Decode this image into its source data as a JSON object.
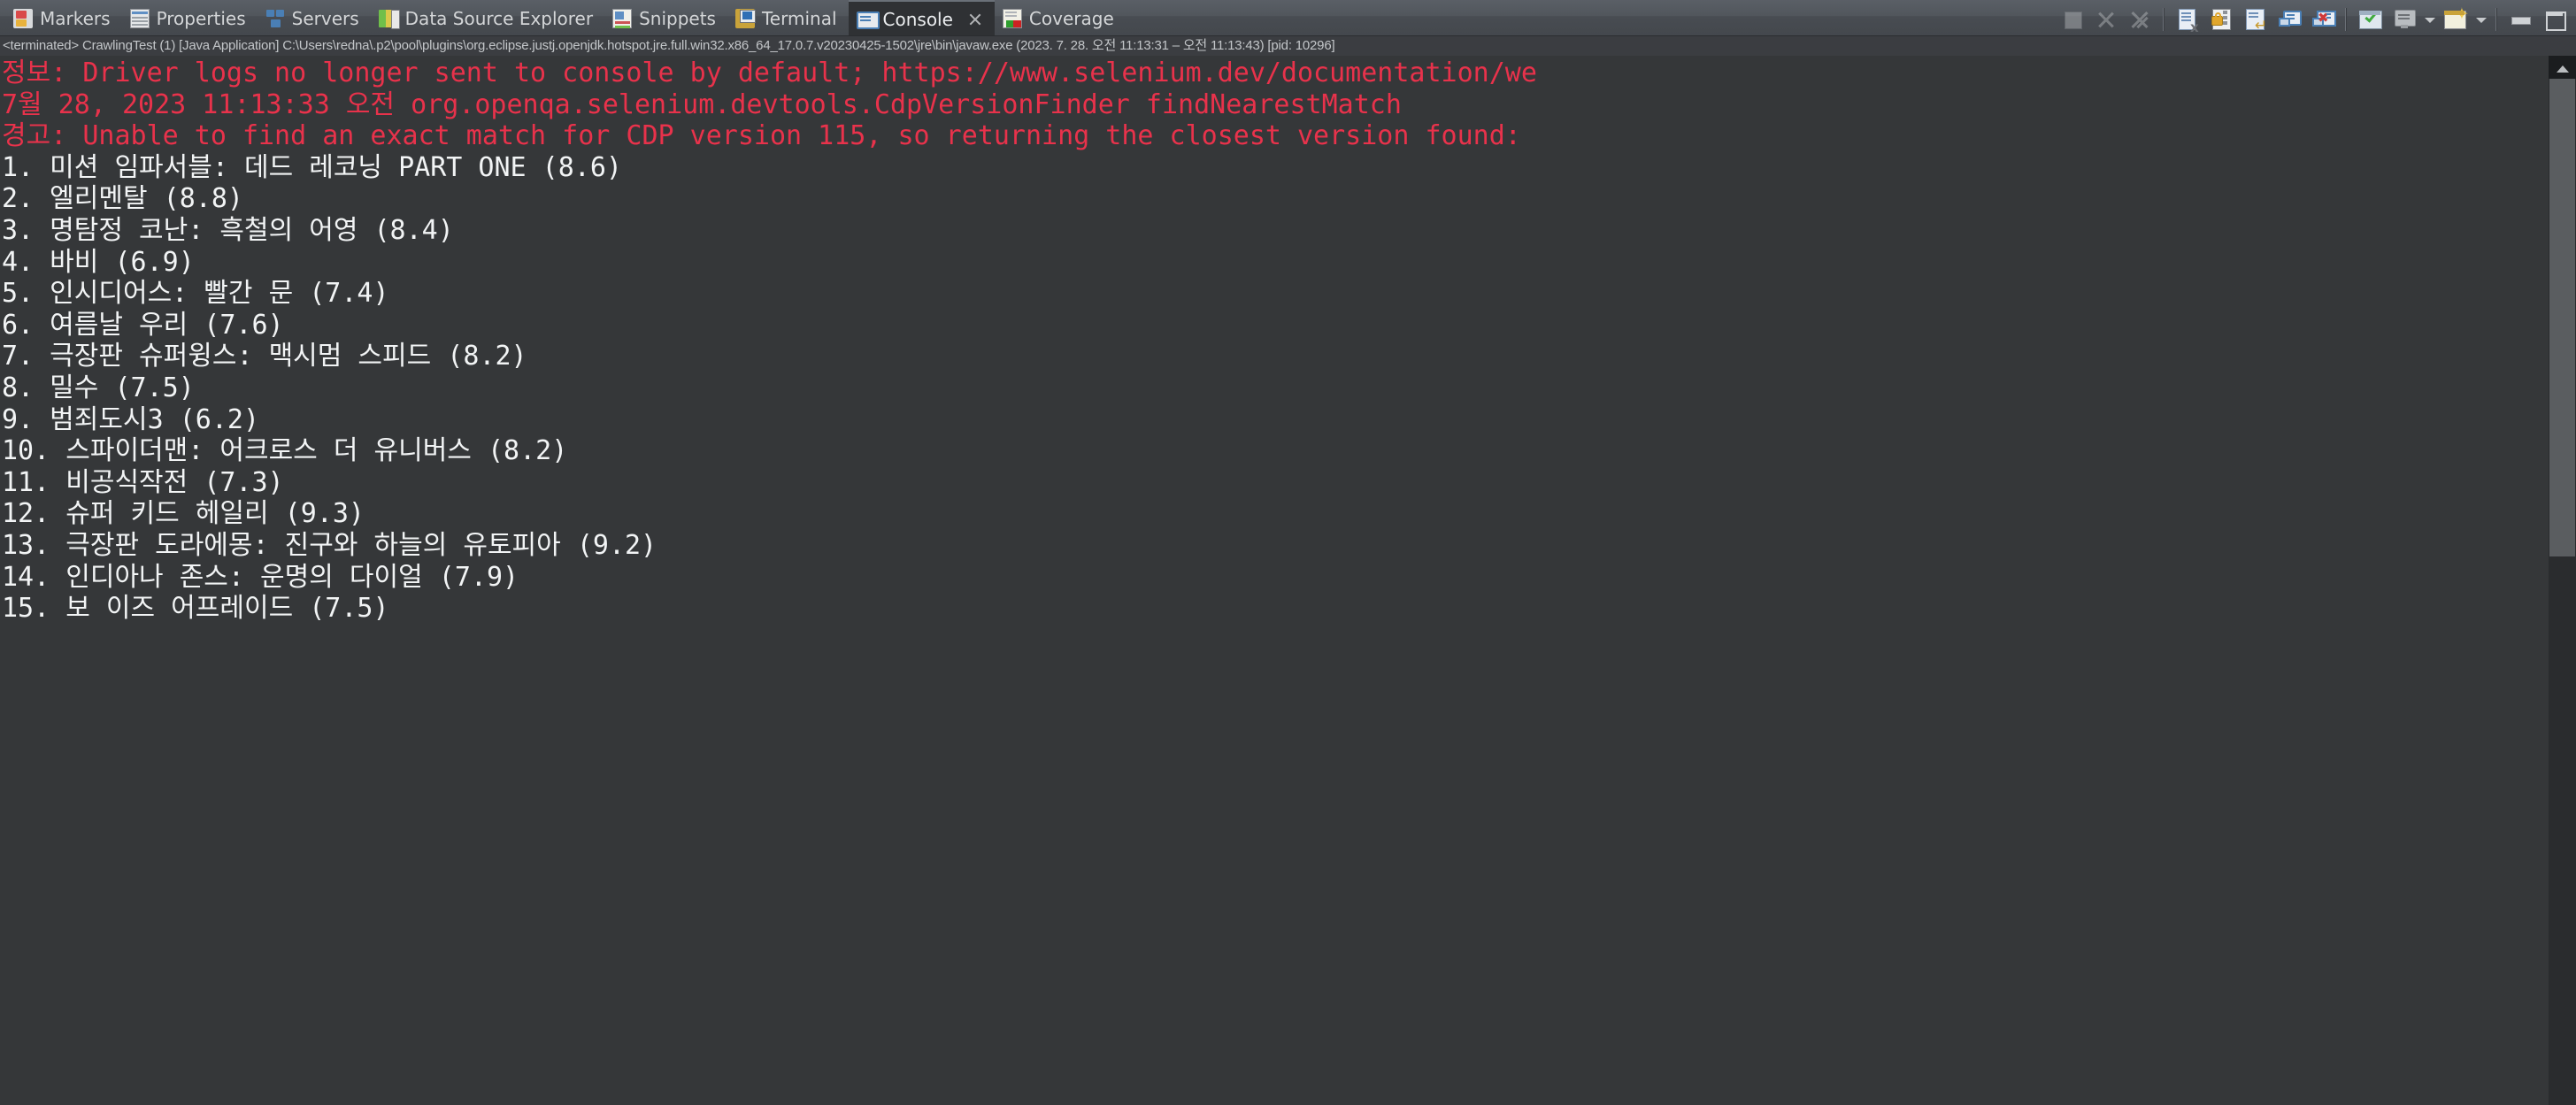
{
  "window": {
    "active_view": "Console"
  },
  "tabs": [
    {
      "label": "Markers",
      "icon": "markers-icon",
      "active": false,
      "closable": false
    },
    {
      "label": "Properties",
      "icon": "properties-icon",
      "active": false,
      "closable": false
    },
    {
      "label": "Servers",
      "icon": "servers-icon",
      "active": false,
      "closable": false
    },
    {
      "label": "Data Source Explorer",
      "icon": "database-icon",
      "active": false,
      "closable": false
    },
    {
      "label": "Snippets",
      "icon": "snippets-icon",
      "active": false,
      "closable": false
    },
    {
      "label": "Terminal",
      "icon": "terminal-icon",
      "active": false,
      "closable": false
    },
    {
      "label": "Console",
      "icon": "console-icon",
      "active": true,
      "closable": true
    },
    {
      "label": "Coverage",
      "icon": "coverage-icon",
      "active": false,
      "closable": false
    }
  ],
  "toolbar": {
    "groups": [
      [
        {
          "name": "terminate-button",
          "icon": "stop-square-icon",
          "enabled": false
        },
        {
          "name": "remove-launch-button",
          "icon": "remove-x-icon",
          "enabled": false
        },
        {
          "name": "remove-all-launches-button",
          "icon": "remove-all-x-icon",
          "enabled": false
        }
      ],
      [
        {
          "name": "clear-console-button",
          "icon": "clear-console-icon",
          "enabled": true
        },
        {
          "name": "scroll-lock-button",
          "icon": "scroll-lock-icon",
          "enabled": true
        },
        {
          "name": "word-wrap-button",
          "icon": "word-wrap-icon",
          "enabled": true
        },
        {
          "name": "show-console-on-output-button",
          "icon": "show-console-icon",
          "enabled": true
        },
        {
          "name": "show-console-on-error-button",
          "icon": "show-console-error-icon",
          "enabled": true
        }
      ],
      [
        {
          "name": "pin-console-button",
          "icon": "pin-console-icon",
          "enabled": true
        },
        {
          "name": "display-selected-console-button",
          "icon": "display-console-icon",
          "enabled": true,
          "dropdown": true
        },
        {
          "name": "open-console-button",
          "icon": "new-console-icon",
          "enabled": true,
          "dropdown": true
        }
      ],
      [
        {
          "name": "minimize-view-button",
          "icon": "minimize-icon",
          "enabled": true
        },
        {
          "name": "maximize-view-button",
          "icon": "maximize-icon",
          "enabled": true
        }
      ]
    ]
  },
  "process_info": {
    "status": "<terminated>",
    "full_line": "<terminated> CrawlingTest (1) [Java Application] C:\\Users\\redna\\.p2\\pool\\plugins\\org.eclipse.justj.openjdk.hotspot.jre.full.win32.x86_64_17.0.7.v20230425-1502\\jre\\bin\\javaw.exe  (2023. 7. 28. 오전 11:13:31 – 오전 11:13:43) [pid: 10296]",
    "launch_name": "CrawlingTest (1)",
    "launch_type": "[Java Application]",
    "jvm_path": "C:\\Users\\redna\\.p2\\pool\\plugins\\org.eclipse.justj.openjdk.hotspot.jre.full.win32.x86_64_17.0.7.v20230425-1502\\jre\\bin\\javaw.exe",
    "time_range": "(2023. 7. 28. 오전 11:13:31 – 오전 11:13:43)",
    "pid": "[pid: 10296]"
  },
  "console": {
    "colors": {
      "error": "#e8324b",
      "output": "#f2f4f5",
      "background": "#353739"
    },
    "lines": [
      {
        "stream": "error",
        "text": "정보: Driver logs no longer sent to console by default; https://www.selenium.dev/documentation/we"
      },
      {
        "stream": "error",
        "text": "7월 28, 2023 11:13:33 오전 org.openqa.selenium.devtools.CdpVersionFinder findNearestMatch"
      },
      {
        "stream": "error",
        "text": "경고: Unable to find an exact match for CDP version 115, so returning the closest version found:"
      },
      {
        "stream": "output",
        "text": "1. 미션 임파서블: 데드 레코닝 PART ONE (8.6)"
      },
      {
        "stream": "output",
        "text": "2. 엘리멘탈 (8.8)"
      },
      {
        "stream": "output",
        "text": "3. 명탐정 코난: 흑철의 어영 (8.4)"
      },
      {
        "stream": "output",
        "text": "4. 바비 (6.9)"
      },
      {
        "stream": "output",
        "text": "5. 인시디어스: 빨간 문 (7.4)"
      },
      {
        "stream": "output",
        "text": "6. 여름날 우리 (7.6)"
      },
      {
        "stream": "output",
        "text": "7. 극장판 슈퍼윙스: 맥시멈 스피드 (8.2)"
      },
      {
        "stream": "output",
        "text": "8. 밀수 (7.5)"
      },
      {
        "stream": "output",
        "text": "9. 범죄도시3 (6.2)"
      },
      {
        "stream": "output",
        "text": "10. 스파이더맨: 어크로스 더 유니버스 (8.2)"
      },
      {
        "stream": "output",
        "text": "11. 비공식작전 (7.3)"
      },
      {
        "stream": "output",
        "text": "12. 슈퍼 키드 헤일리 (9.3)"
      },
      {
        "stream": "output",
        "text": "13. 극장판 도라에몽: 진구와 하늘의 유토피아 (9.2)"
      },
      {
        "stream": "output",
        "text": "14. 인디아나 존스: 운명의 다이얼 (7.9)"
      },
      {
        "stream": "output",
        "text": "15. 보 이즈 어프레이드 (7.5)"
      }
    ]
  },
  "scrollbar": {
    "vertical": {
      "arrow_up": "▲",
      "thumb_position_percent": 2,
      "thumb_size_percent": 46
    }
  }
}
